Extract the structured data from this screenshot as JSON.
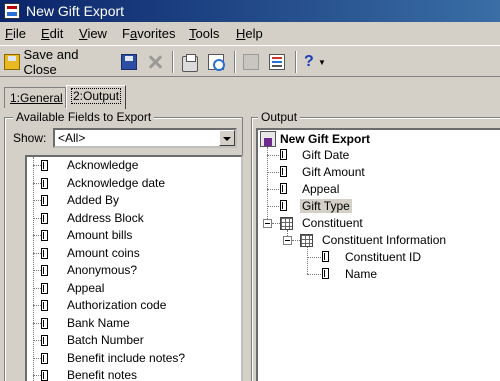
{
  "window": {
    "title": "New Gift Export"
  },
  "menu": {
    "items": [
      "File",
      "Edit",
      "View",
      "Favorites",
      "Tools",
      "Help"
    ],
    "mnemonics": [
      "F",
      "E",
      "V",
      "a",
      "T",
      "H"
    ]
  },
  "toolbar": {
    "save_close_label": "Save and Close",
    "icons": [
      "save-close-icon",
      "save-icon",
      "delete-icon",
      "print-icon",
      "print-preview-icon",
      "disabled-icon",
      "properties-icon",
      "help-icon",
      "dropdown-caret-icon"
    ]
  },
  "tabs": [
    {
      "label": "1:General",
      "active": false
    },
    {
      "label": "2:Output",
      "active": true
    }
  ],
  "available": {
    "group_label": "Available Fields to Export",
    "show_label": "Show:",
    "show_value": "<All>",
    "fields": [
      "Acknowledge",
      "Acknowledge date",
      "Added By",
      "Address Block",
      "Amount bills",
      "Amount coins",
      "Anonymous?",
      "Appeal",
      "Authorization code",
      "Bank Name",
      "Batch Number",
      "Benefit include notes?",
      "Benefit notes"
    ]
  },
  "output": {
    "group_label": "Output",
    "root": "New Gift Export",
    "nodes": [
      {
        "label": "Gift Date",
        "level": 1,
        "type": "field"
      },
      {
        "label": "Gift Amount",
        "level": 1,
        "type": "field"
      },
      {
        "label": "Appeal",
        "level": 1,
        "type": "field"
      },
      {
        "label": "Gift Type",
        "level": 1,
        "type": "field",
        "highlighted": true
      },
      {
        "label": "Constituent",
        "level": 1,
        "type": "group",
        "expanded": true
      },
      {
        "label": "Constituent Information",
        "level": 2,
        "type": "group",
        "expanded": true
      },
      {
        "label": "Constituent ID",
        "level": 3,
        "type": "field"
      },
      {
        "label": "Name",
        "level": 3,
        "type": "field"
      }
    ]
  }
}
